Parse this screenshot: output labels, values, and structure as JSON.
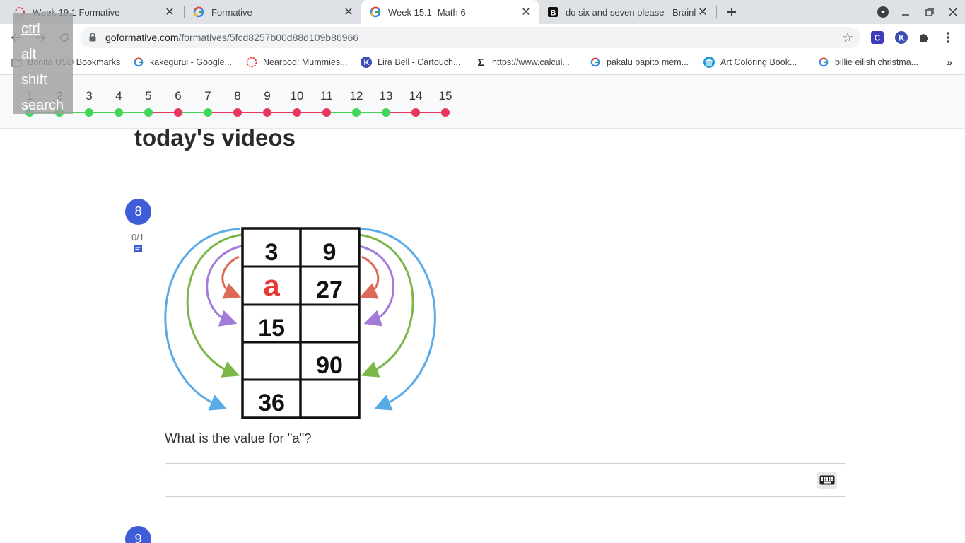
{
  "browser": {
    "tabs": [
      {
        "title": "Week 19.1 Formative",
        "icon": "formative-ring-icon",
        "active": false
      },
      {
        "title": "Formative",
        "icon": "google-g-icon",
        "active": false
      },
      {
        "title": "Week 15.1- Math 6",
        "icon": "google-g-icon",
        "active": true
      },
      {
        "title": "do six and seven please - Brainly",
        "icon": "brainly-b-icon",
        "active": false
      }
    ],
    "close_glyph": "✕",
    "url_host": "goformative.com",
    "url_path": "/formatives/5fcd8257b00d88d109b86966",
    "bookmarks": [
      {
        "label": "Bonita USD Bookmarks",
        "icon": "folder-icon"
      },
      {
        "label": "kakegurui - Google...",
        "icon": "google-g-icon"
      },
      {
        "label": "Nearpod: Mummies...",
        "icon": "nearpod-icon"
      },
      {
        "label": "Lira Bell - Cartouch...",
        "icon": "k-circle-icon"
      },
      {
        "label": "https://www.calcul...",
        "icon": "sigma-icon"
      },
      {
        "label": "pakalu papito mem...",
        "icon": "google-g-icon"
      },
      {
        "label": "Art Coloring Book...",
        "icon": "museum-icon"
      },
      {
        "label": "billie eilish christma...",
        "icon": "google-g-icon"
      }
    ],
    "bookmarks_more": "»"
  },
  "key_overlay": [
    "ctrl",
    "alt",
    "shift",
    "search"
  ],
  "progress": {
    "numbers": [
      "1",
      "2",
      "3",
      "4",
      "5",
      "6",
      "7",
      "8",
      "9",
      "10",
      "11",
      "12",
      "13",
      "14",
      "15"
    ],
    "status": [
      "green",
      "green",
      "green",
      "green",
      "green",
      "red",
      "green",
      "red",
      "red",
      "red",
      "red",
      "green",
      "green",
      "red",
      "red"
    ]
  },
  "colors": {
    "green": "#42d65a",
    "red": "#e8365e",
    "accent": "#3f5dd8"
  },
  "content": {
    "section_title": "today's videos",
    "question_number": "8",
    "score": "0/1",
    "question_text": "What is the value for \"a\"?",
    "next_question_number": "9"
  },
  "figure": {
    "left_column": [
      "3",
      "a",
      "15",
      "",
      "36"
    ],
    "right_column": [
      "9",
      "27",
      "",
      "90",
      ""
    ]
  }
}
